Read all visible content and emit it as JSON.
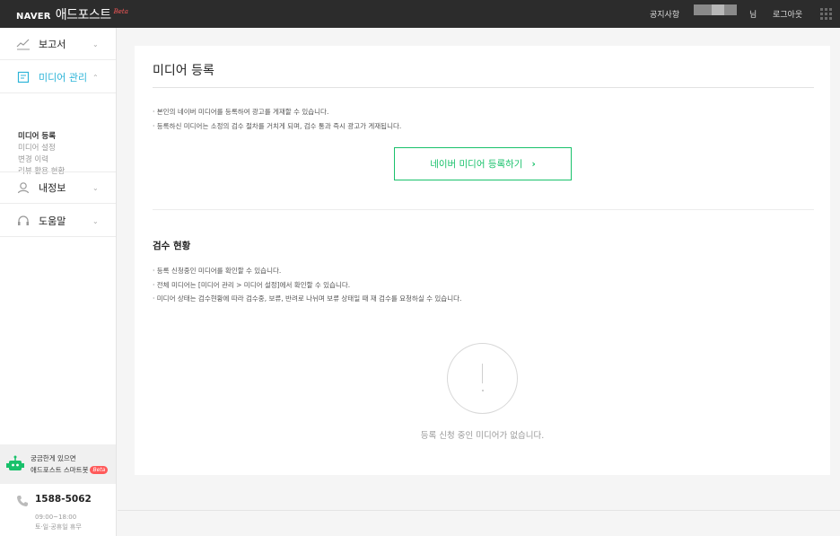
{
  "topbar": {
    "brand_naver": "NAVER",
    "brand_name": "애드포스트",
    "brand_beta": "Beta",
    "notice": "공지사항",
    "user_suffix": "님",
    "logout": "로그아웃"
  },
  "sidebar": {
    "items": [
      {
        "label": "보고서",
        "icon": "chart-icon"
      },
      {
        "label": "미디어 관리",
        "icon": "document-icon"
      },
      {
        "label": "내정보",
        "icon": "person-icon"
      },
      {
        "label": "도움말",
        "icon": "headset-icon"
      }
    ],
    "subitems": [
      "미디어 등록",
      "미디어 설정",
      "변경 이력",
      "리뷰 활용 현황"
    ],
    "bot_line1": "궁금한게 있으면",
    "bot_line2": "애드포스트 스마트봇",
    "bot_badge": "Beta",
    "phone": "1588-5062",
    "hours": "09:00~18:00",
    "holidays": "토·일·공휴일 휴무"
  },
  "main": {
    "title": "미디어 등록",
    "bullets1": [
      "· 본인의 네이버 미디어를 등록하여 광고를 게재할 수 있습니다.",
      "· 등록하신 미디어는 소정의 검수 절차를 거치게 되며, 검수 통과 즉시 광고가 게재됩니다."
    ],
    "register_button": "네이버 미디어 등록하기",
    "register_arrow": "›",
    "section_title": "검수 현황",
    "bullets2": [
      "· 등록 신청중인 미디어를 확인할 수 있습니다.",
      "· 전체 미디어는 [미디어 관리 > 미디어 설정]에서 확인할 수 있습니다.",
      "· 미디어 상태는 검수현황에 따라 검수중, 보류, 반려로 나뉘며 보류 상태일 때 재 검수를 요청하실 수 있습니다."
    ],
    "empty_text": "등록 신청 중인 미디어가 없습니다."
  },
  "colors": {
    "accent_green": "#19c16b",
    "active_blue": "#2db4d8",
    "topbar_bg": "#2c2c2c",
    "beta_red": "#ff5a5a"
  }
}
